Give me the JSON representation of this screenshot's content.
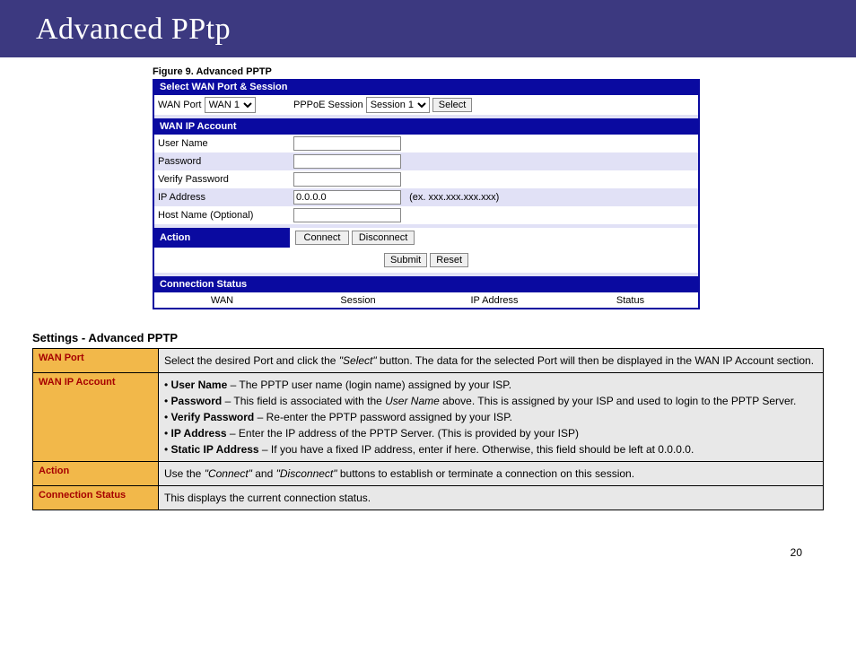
{
  "header": {
    "title": "Advanced PPtp"
  },
  "figure": {
    "caption": "Figure 9. Advanced PPTP",
    "sec_select": "Select WAN Port & Session",
    "wan_port_label": "WAN Port",
    "wan_port_value": "WAN 1",
    "pppoe_label": "PPPoE Session",
    "pppoe_value": "Session 1",
    "select_btn": "Select",
    "sec_wanip": "WAN IP Account",
    "f_user": "User Name",
    "f_pass": "Password",
    "f_vpass": "Verify Password",
    "f_ip": "IP Address",
    "ip_value": "0.0.0.0",
    "ip_example": "(ex. xxx.xxx.xxx.xxx)",
    "f_host": "Host Name (Optional)",
    "sec_action": "Action",
    "connect_btn": "Connect",
    "disconnect_btn": "Disconnect",
    "submit_btn": "Submit",
    "reset_btn": "Reset",
    "sec_conn": "Connection Status",
    "col_wan": "WAN",
    "col_session": "Session",
    "col_ip": "IP Address",
    "col_status": "Status"
  },
  "settings": {
    "title": "Settings - Advanced PPTP",
    "rows": {
      "wan_port": {
        "k": "WAN Port",
        "v": "Select the desired Port and click the \"Select\" button. The data for the selected Port will then be displayed in the WAN IP Account section."
      },
      "wan_ip": {
        "k": "WAN IP Account"
      },
      "b_user_k": "User Name",
      "b_user_v": " – The PPTP user name (login name) assigned by your ISP.",
      "b_pass_k": "Password",
      "b_pass_v": " – This field is associated with the User Name above. This is assigned by your ISP and used to login to the PPTP Server.",
      "b_vpass_k": "Verify Password",
      "b_vpass_v": " – Re-enter the PPTP password assigned by your ISP.",
      "b_ip_k": "IP Address",
      "b_ip_v": " – Enter the IP address of the PPTP Server. (This is provided by your ISP)",
      "b_sip_k": "Static IP Address",
      "b_sip_v": " – If you have a fixed IP address, enter if here. Otherwise, this field should be left at 0.0.0.0.",
      "action": {
        "k": "Action",
        "v": "Use the \"Connect\" and \"Disconnect\" buttons to establish or terminate a connection on this session."
      },
      "conn": {
        "k": "Connection Status",
        "v": "This displays the current connection status."
      }
    }
  },
  "page_number": "20"
}
